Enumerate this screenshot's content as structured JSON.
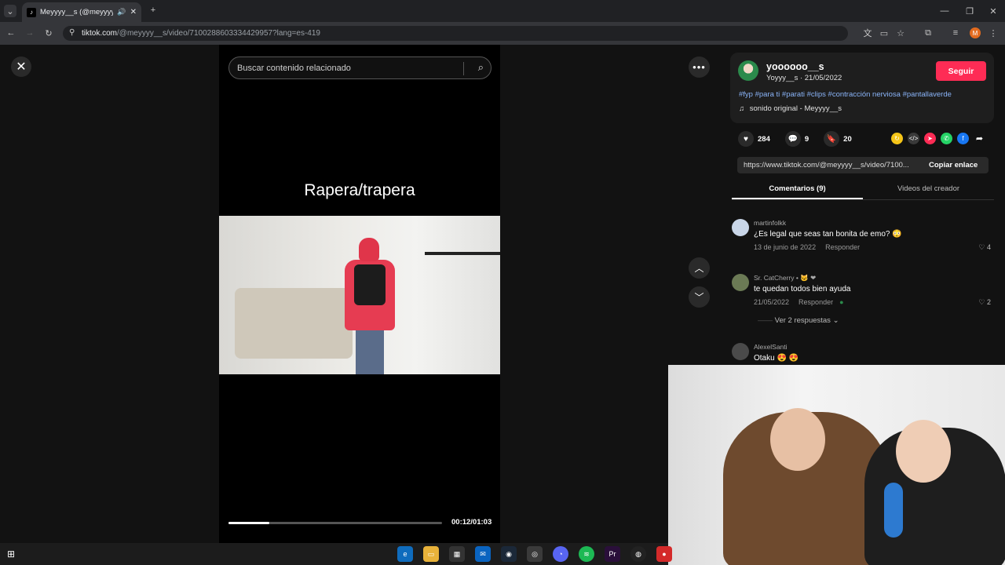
{
  "browser": {
    "tab_title": "Meyyyy__s (@meyyyy__s) |",
    "tab_favicon": "tiktok-icon",
    "url_domain": "tiktok.com",
    "url_path": "/@meyyyy__s/video/7100288603334429957?lang=es-419"
  },
  "video": {
    "search_placeholder": "Buscar contenido relacionado",
    "caption": "Rapera/trapera",
    "time": "00:12/01:03",
    "progress": 0.19
  },
  "author": {
    "username": "yoooooo__s",
    "subline": "Yoyyy__s · 21/05/2022",
    "follow_label": "Seguir",
    "hashtags": "#fyp #para ti #parati #clips #contracción nerviosa #pantallaverde",
    "sound": "sonido original - Meyyyy__s"
  },
  "stats": {
    "likes": "284",
    "comments": "9",
    "saves": "20"
  },
  "share": {
    "link": "https://www.tiktok.com/@meyyyy__s/video/7100...",
    "copy_label": "Copiar enlace",
    "colors": [
      "#f5c518",
      "#3a3a3a",
      "#fe2c55",
      "#25d366",
      "#1877f2",
      "#121212"
    ]
  },
  "tabs": {
    "comments": "Comentarios (9)",
    "creator_videos": "Videos del creador"
  },
  "comments": [
    {
      "user": "martinfolkk",
      "text": "¿Es legal que seas tan bonita de emo? 😳",
      "date": "13 de junio de 2022",
      "reply": "Responder",
      "likes": "4"
    },
    {
      "user": "Sr. CatCherry • 🐱 ❤",
      "text": "te quedan todos bien ayuda",
      "date": "21/05/2022",
      "reply": "Responder",
      "likes": "2"
    },
    {
      "user": "AlexelSanti",
      "text": "Otaku 😍 😍"
    }
  ],
  "replies_label": "Ver 2 respuestas"
}
